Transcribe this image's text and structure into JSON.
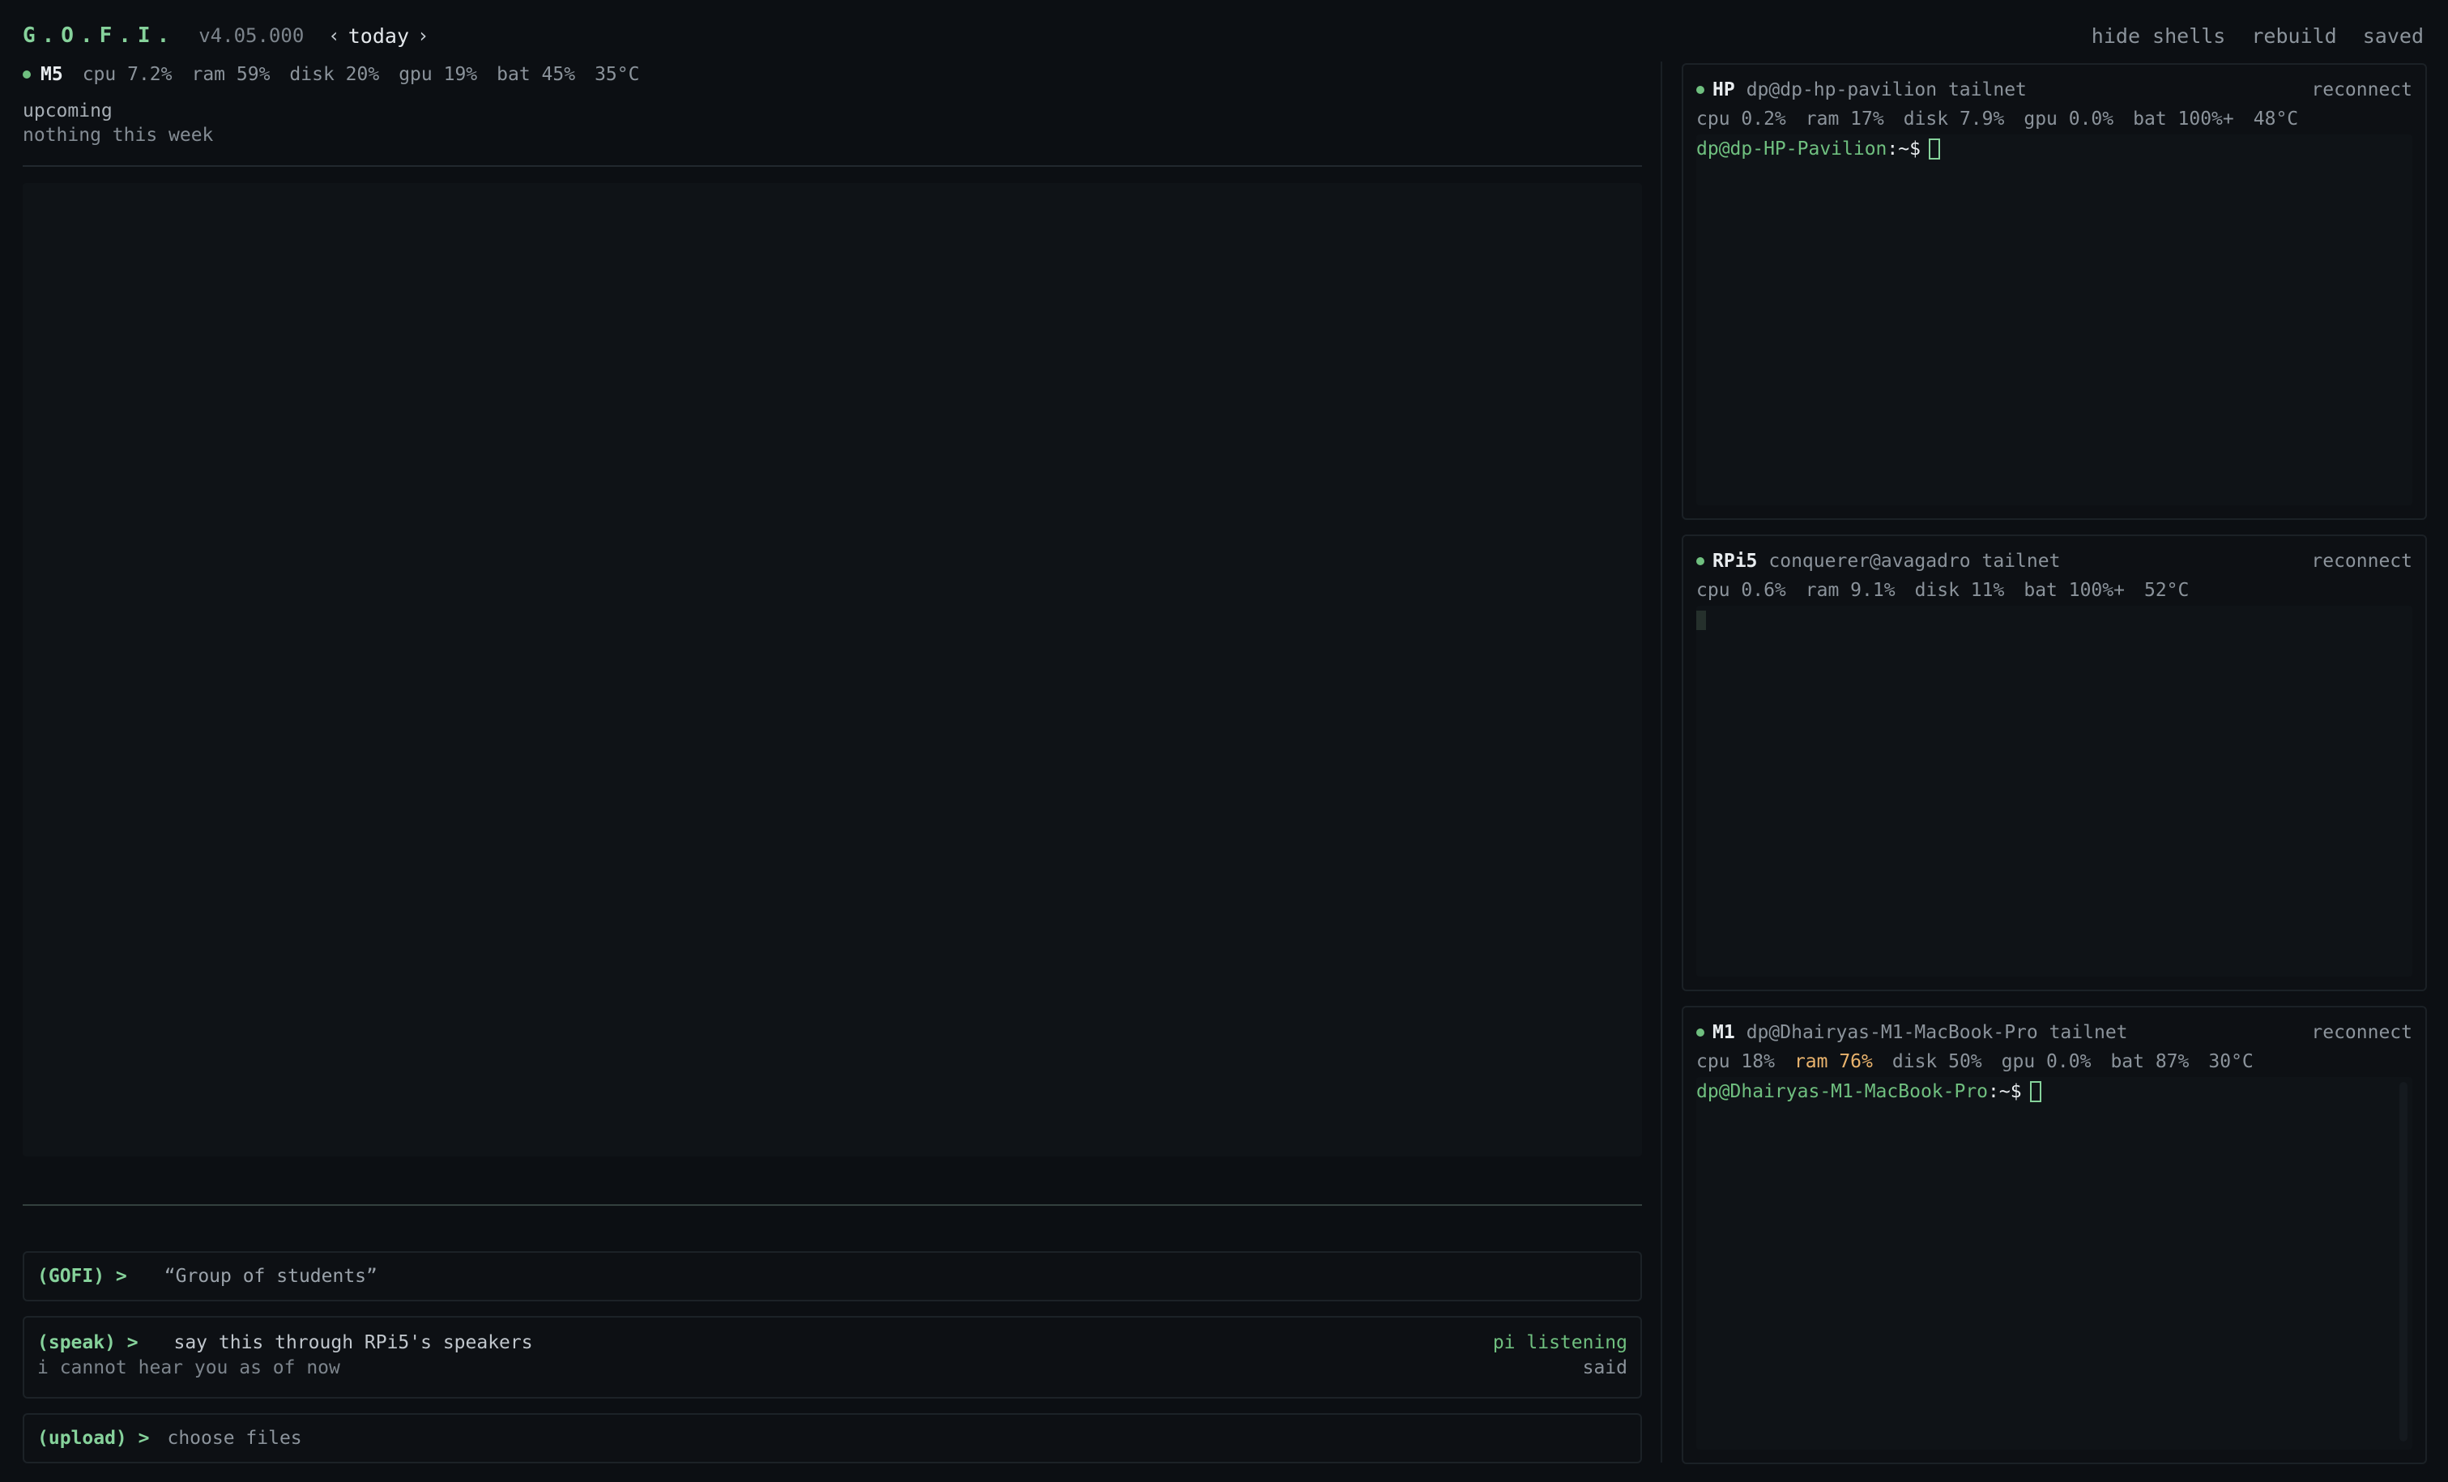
{
  "header": {
    "brand": "G.O.F.I.",
    "version": "v4.05.000",
    "nav_prev": "‹",
    "nav_label": "today",
    "nav_next": "›",
    "actions": {
      "hide_shells": "hide shells",
      "rebuild": "rebuild",
      "saved": "saved"
    }
  },
  "local": {
    "host": "M5",
    "stats": {
      "cpu": "cpu 7.2%",
      "ram": "ram 59%",
      "disk": "disk 20%",
      "gpu": "gpu 19%",
      "bat": "bat 45%",
      "temp": "35°C"
    },
    "upcoming_label": "upcoming",
    "upcoming_text": "nothing this week"
  },
  "commands": {
    "gofi": {
      "prompt": "(GOFI) >",
      "text": "“Group of students”"
    },
    "speak": {
      "prompt": "(speak) >",
      "text": "say this through RPi5's speakers",
      "status": "pi listening",
      "response": "i cannot hear you as of now",
      "response_label": "said"
    },
    "upload": {
      "prompt": "(upload) >",
      "text": "choose files"
    }
  },
  "shells": {
    "hp": {
      "name": "HP",
      "user": "dp@dp-hp-pavilion tailnet",
      "reconnect": "reconnect",
      "stats": {
        "cpu": "cpu 0.2%",
        "ram": "ram 17%",
        "disk": "disk 7.9%",
        "gpu": "gpu 0.0%",
        "bat": "bat 100%+",
        "temp": "48°C"
      },
      "prompt_user": "dp@dp-HP-Pavilion",
      "prompt_sym": ":~$"
    },
    "rpi": {
      "name": "RPi5",
      "user": "conquerer@avagadro tailnet",
      "reconnect": "reconnect",
      "stats": {
        "cpu": "cpu 0.6%",
        "ram": "ram 9.1%",
        "disk": "disk 11%",
        "bat": "bat 100%+",
        "temp": "52°C"
      }
    },
    "m1": {
      "name": "M1",
      "user": "dp@Dhairyas-M1-MacBook-Pro tailnet",
      "reconnect": "reconnect",
      "stats": {
        "cpu": "cpu 18%",
        "ram": "ram 76%",
        "disk": "disk 50%",
        "gpu": "gpu 0.0%",
        "bat": "bat 87%",
        "temp": "30°C"
      },
      "prompt_user": "dp@Dhairyas-M1-MacBook-Pro",
      "prompt_sym": ":~$"
    }
  },
  "colors": {
    "accent": "#86d29b",
    "status_ok": "#6fbf7f",
    "warn": "#e9b36d",
    "background": "#0c0f13"
  },
  "icons": {
    "status_dot": "status-dot-icon",
    "prev": "chevron-left-icon",
    "next": "chevron-right-icon",
    "cursor": "terminal-cursor-icon"
  }
}
